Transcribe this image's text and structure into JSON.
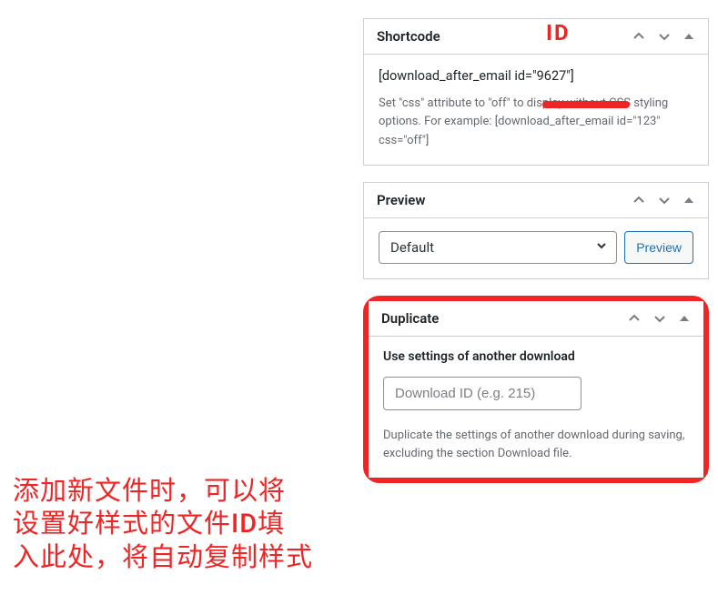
{
  "annotations": {
    "id_label": "ID",
    "cn_text": "添加新文件时，可以将\n设置好样式的文件ID填\n入此处，将自动复制样式"
  },
  "shortcode": {
    "title": "Shortcode",
    "value": "[download_after_email id=\"9627\"]",
    "help": "Set \"css\" attribute to \"off\" to display without CSS styling options. For example: [download_after_email id=\"123\" css=\"off\"]"
  },
  "preview": {
    "title": "Preview",
    "selected": "Default",
    "button": "Preview"
  },
  "duplicate": {
    "title": "Duplicate",
    "field_label": "Use settings of another download",
    "placeholder": "Download ID (e.g. 215)",
    "help": "Duplicate the settings of another download during saving, excluding the section Download file."
  }
}
